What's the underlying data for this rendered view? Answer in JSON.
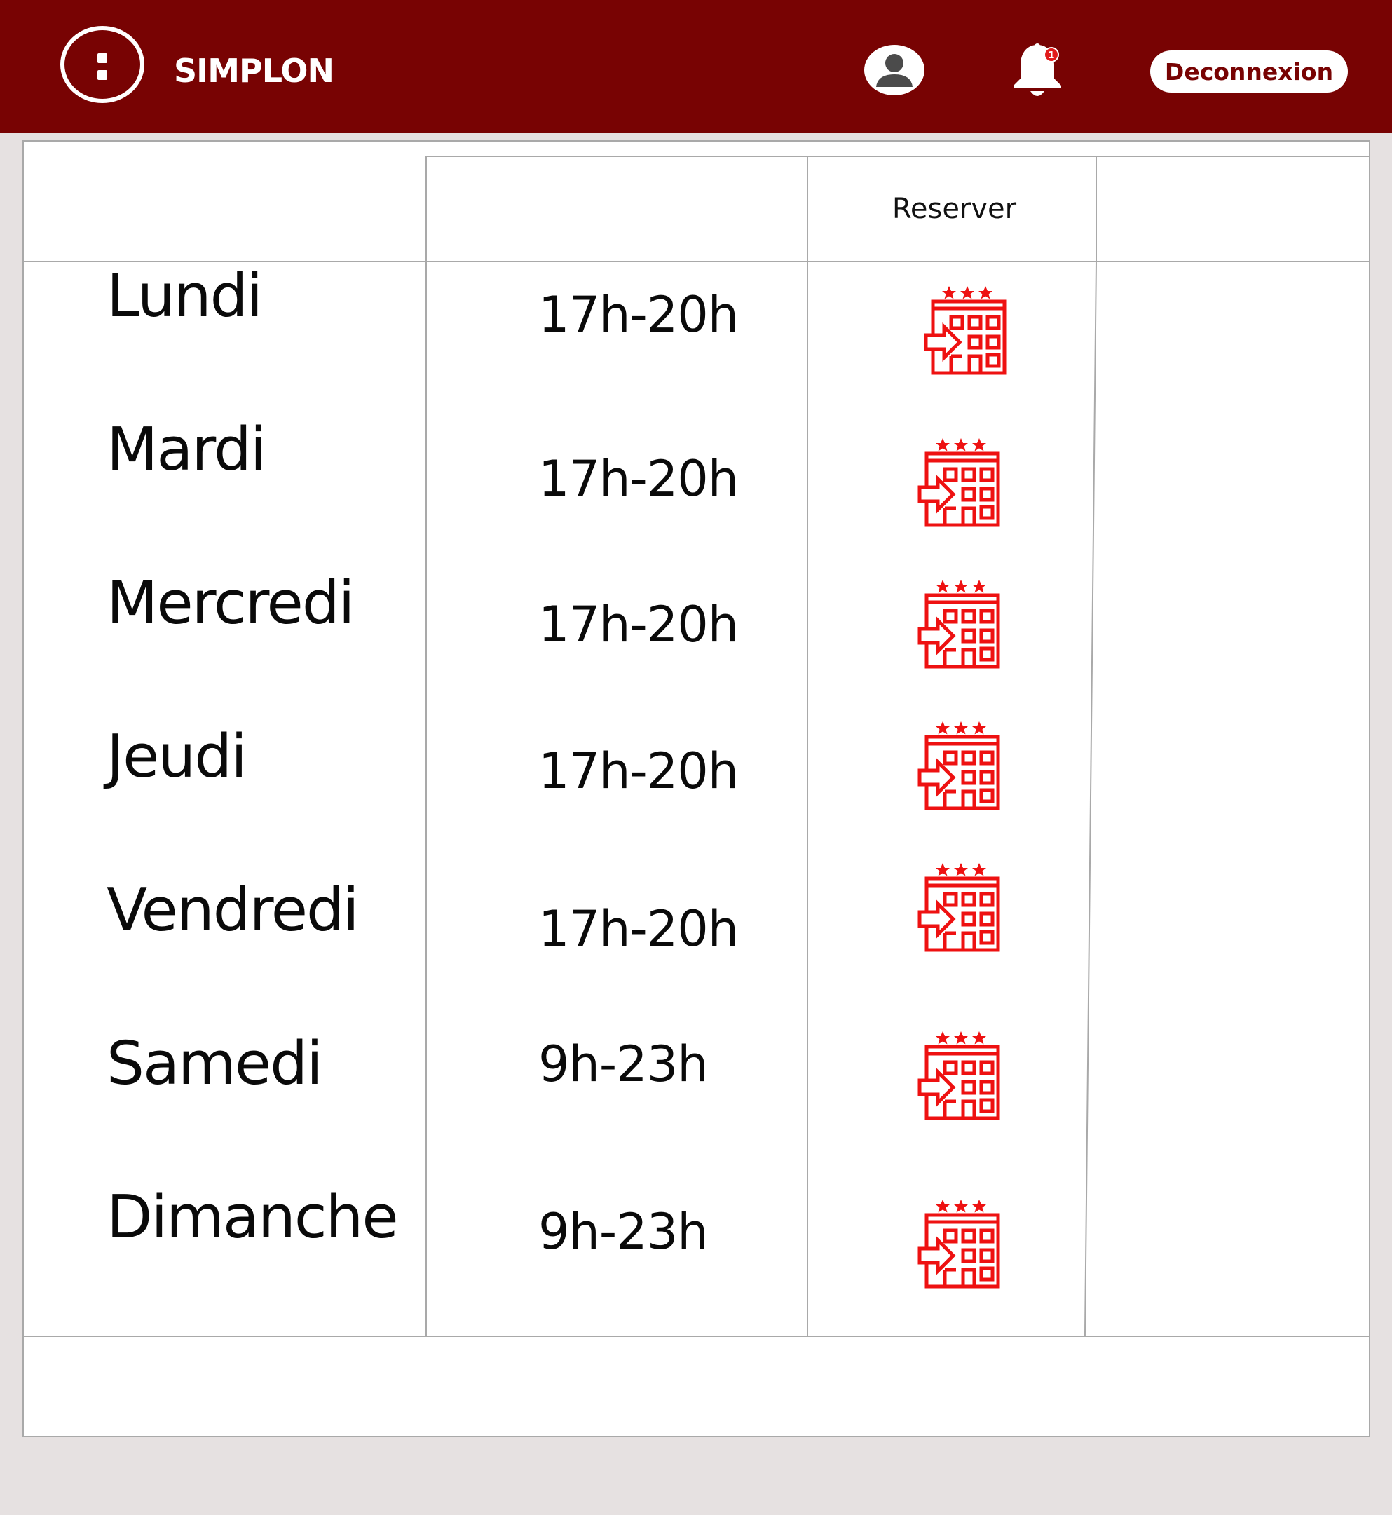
{
  "header": {
    "brand": "SIMPLON",
    "notification_count": "1",
    "logout_label": "Deconnexion",
    "colors": {
      "bar": "#780303",
      "badge": "#e11b1b"
    }
  },
  "table": {
    "header": {
      "reserver": "Reserver"
    },
    "rows": [
      {
        "day": "Lundi",
        "hours": "17h-20h"
      },
      {
        "day": "Mardi",
        "hours": "17h-20h"
      },
      {
        "day": "Mercredi",
        "hours": "17h-20h"
      },
      {
        "day": "Jeudi",
        "hours": "17h-20h"
      },
      {
        "day": "Vendredi",
        "hours": "17h-20h"
      },
      {
        "day": "Samedi",
        "hours": "9h-23h"
      },
      {
        "day": "Dimanche",
        "hours": "9h-23h"
      }
    ],
    "reserve_icon": "hotel-checkin-icon",
    "icon_color": "#ee1111"
  }
}
